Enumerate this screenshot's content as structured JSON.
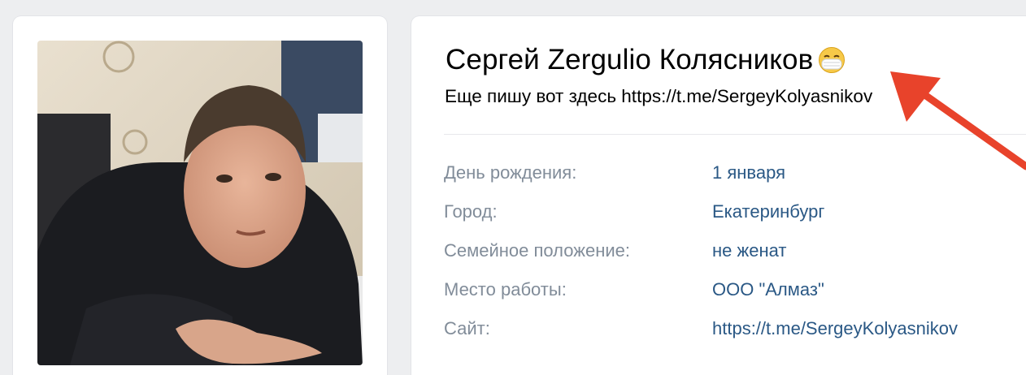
{
  "profile": {
    "name": "Сергей Zergulio Колясников",
    "status_emoji": "mask-face-emoji",
    "status": "Еще пишу вот здесь https://t.me/SergeyKolyasnikov"
  },
  "info": {
    "birthday_label": "День рождения:",
    "birthday_value": "1 января",
    "city_label": "Город:",
    "city_value": "Екатеринбург",
    "family_label": "Семейное положение:",
    "family_value": "не женат",
    "work_label": "Место работы:",
    "work_value": "ООО \"Алмаз\"",
    "site_label": "Сайт:",
    "site_value": "https://t.me/SergeyKolyasnikov"
  },
  "colors": {
    "background": "#edeef0",
    "card": "#ffffff",
    "label": "#818c99",
    "link": "#2a5885",
    "annotation_arrow": "#e8432b"
  }
}
